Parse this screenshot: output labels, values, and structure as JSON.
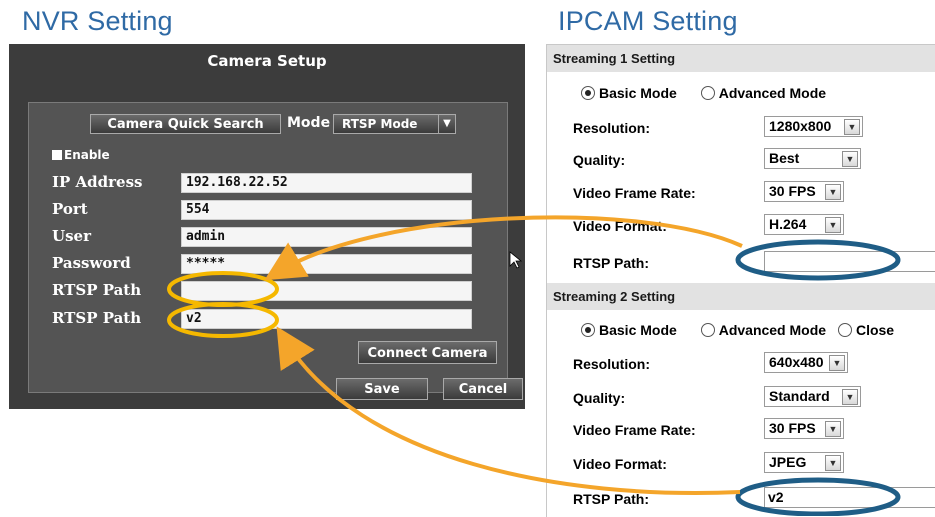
{
  "titles": {
    "nvr": "NVR Setting",
    "ipcam": "IPCAM Setting"
  },
  "nvr": {
    "panel_title": "Camera Setup",
    "quick_search_label": "Camera Quick Search",
    "mode_label": "Mode",
    "mode_value": "RTSP Mode",
    "enable_label": "Enable",
    "fields": [
      {
        "label": "IP Address",
        "value": "192.168.22.52"
      },
      {
        "label": "Port",
        "value": "554"
      },
      {
        "label": "User",
        "value": "admin"
      },
      {
        "label": "Password",
        "value": "*****"
      },
      {
        "label": "RTSP Path",
        "value": ""
      },
      {
        "label": "RTSP Path",
        "value": "v2"
      }
    ],
    "connect_label": "Connect Camera",
    "save_label": "Save",
    "cancel_label": "Cancel"
  },
  "ipcam": {
    "stream1": {
      "header": "Streaming 1 Setting",
      "basic_mode": "Basic Mode",
      "advanced_mode": "Advanced Mode",
      "resolution_label": "Resolution:",
      "resolution_value": "1280x800",
      "quality_label": "Quality:",
      "quality_value": "Best",
      "framerate_label": "Video Frame Rate:",
      "framerate_value": "30 FPS",
      "format_label": "Video Format:",
      "format_value": "H.264",
      "rtsp_label": "RTSP Path:",
      "rtsp_value": ""
    },
    "stream2": {
      "header": "Streaming 2 Setting",
      "basic_mode": "Basic Mode",
      "advanced_mode": "Advanced Mode",
      "close_mode": "Close",
      "resolution_label": "Resolution:",
      "resolution_value": "640x480",
      "quality_label": "Quality:",
      "quality_value": "Standard",
      "framerate_label": "Video Frame Rate:",
      "framerate_value": "30 FPS",
      "format_label": "Video Format:",
      "format_value": "JPEG",
      "rtsp_label": "RTSP Path:",
      "rtsp_value": "v2"
    }
  },
  "colors": {
    "title_blue": "#2f6aa5",
    "nvr_highlight": "#f5b800",
    "ipcam_highlight": "#1f5d86",
    "arrow": "#f4a52a"
  }
}
